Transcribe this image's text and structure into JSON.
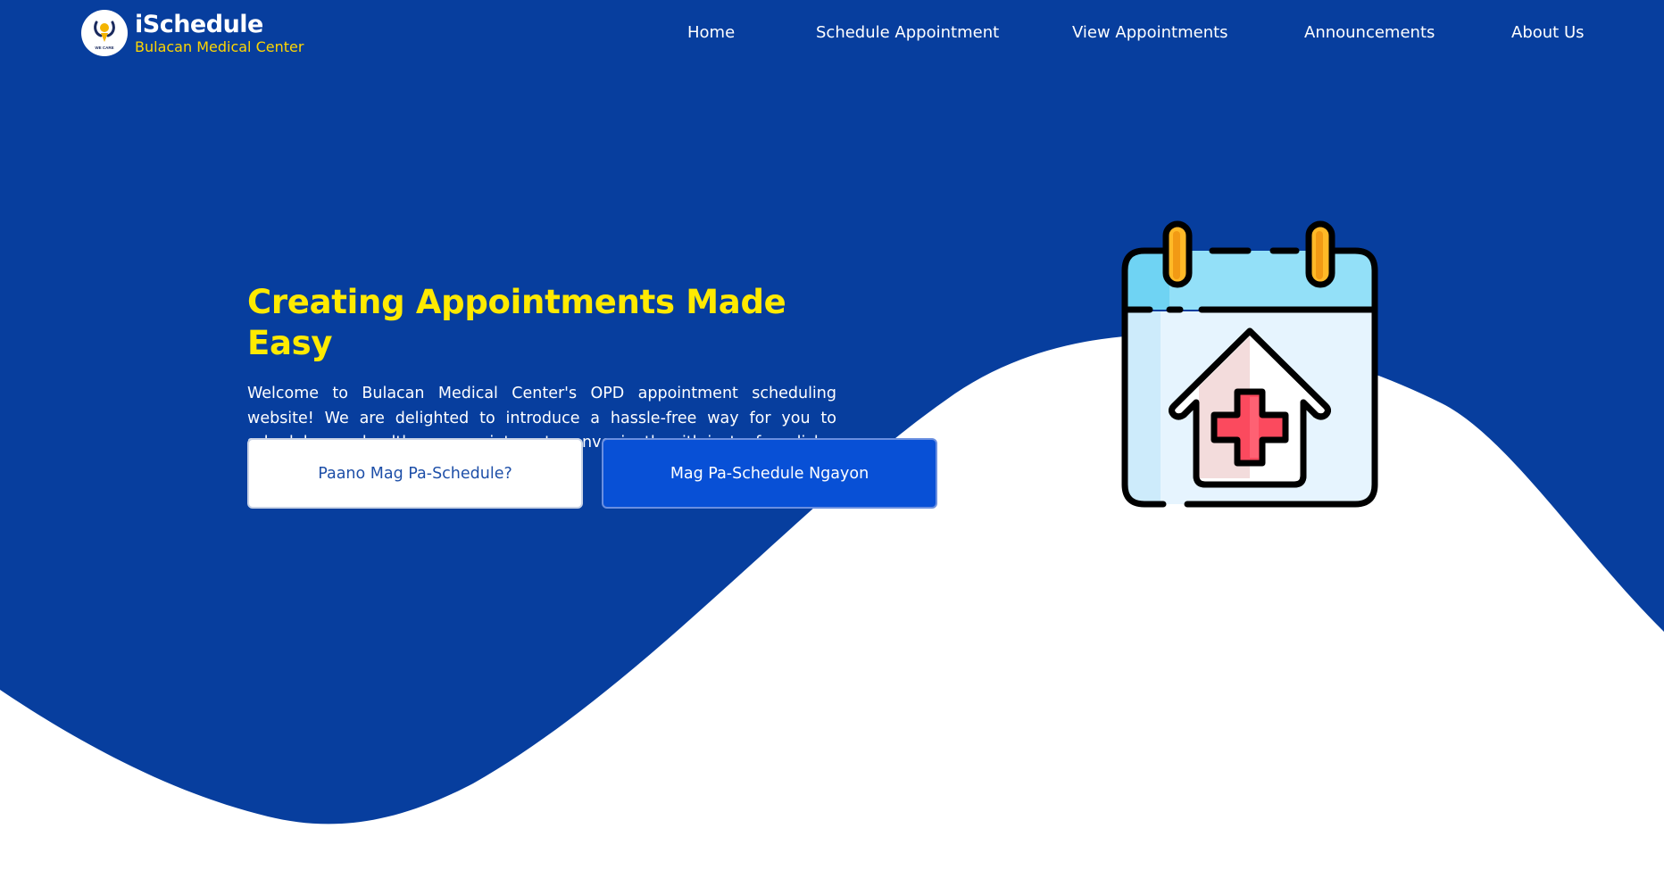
{
  "brand": {
    "title": "iSchedule",
    "subtitle": "Bulacan Medical Center",
    "logo_icon": "we-care-logo-icon",
    "logo_text": "WE CARE"
  },
  "nav": {
    "items": [
      {
        "label": "Home"
      },
      {
        "label": "Schedule Appointment"
      },
      {
        "label": "View Appointments"
      },
      {
        "label": "Announcements"
      },
      {
        "label": "About Us"
      }
    ]
  },
  "hero": {
    "title": "Creating Appointments Made Easy",
    "description": "Welcome to Bulacan Medical Center's OPD appointment scheduling website! We are delighted to introduce a hassle-free way for you to schedule your healthcare appointments conveniently with just a few clicks.",
    "buttons": {
      "how_to": "Paano Mag Pa-Schedule?",
      "schedule_now": "Mag Pa-Schedule Ngayon"
    },
    "illustration_icon": "calendar-hospital-icon"
  },
  "colors": {
    "primary_blue": "#073e9e",
    "title_yellow": "#ffea00",
    "subtitle_yellow": "#ffd600",
    "button_blue": "#0850d6",
    "background": "#ffffff"
  }
}
